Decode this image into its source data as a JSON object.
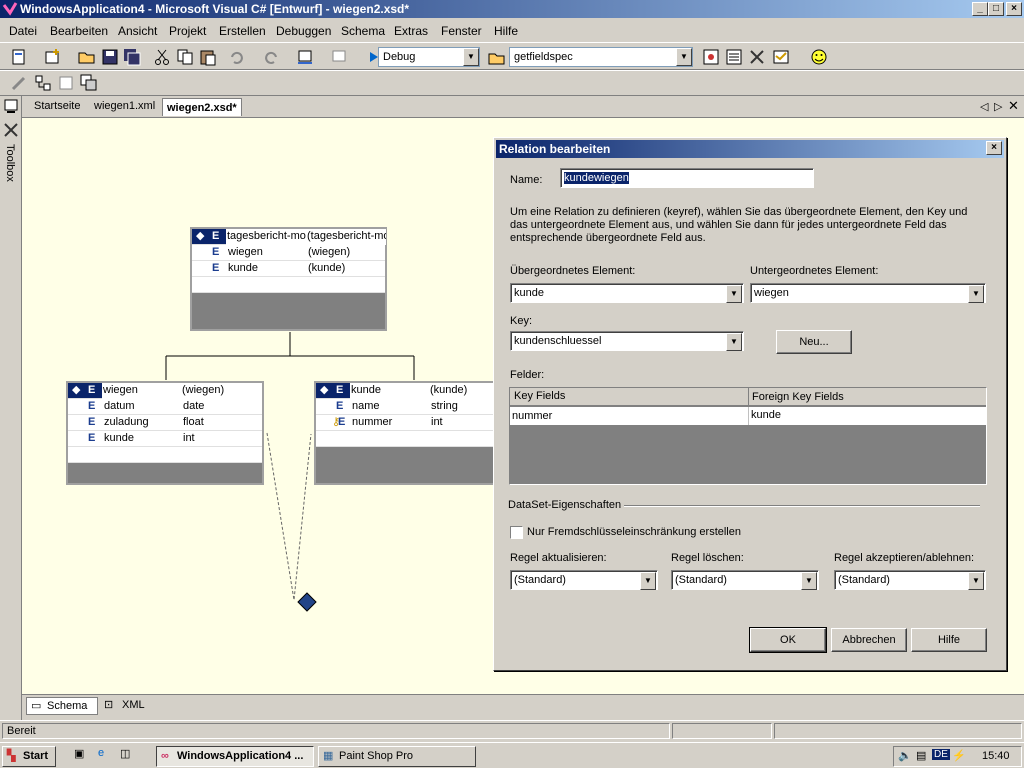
{
  "window": {
    "title": "WindowsApplication4 - Microsoft Visual C# [Entwurf] - wiegen2.xsd*"
  },
  "menu": [
    "Datei",
    "Bearbeiten",
    "Ansicht",
    "Projekt",
    "Erstellen",
    "Debuggen",
    "Schema",
    "Extras",
    "Fenster",
    "Hilfe"
  ],
  "toolbar": {
    "config": "Debug",
    "search": "getfieldspec"
  },
  "tabs": [
    "Startseite",
    "wiegen1.xml",
    "wiegen2.xsd*"
  ],
  "side": {
    "toolbox": "Toolbox"
  },
  "schema": {
    "root": {
      "rows": [
        {
          "t": "E",
          "name": "tagesbericht-mo",
          "type": "(tagesbericht-mo"
        },
        {
          "t": "E",
          "name": "wiegen",
          "type": "(wiegen)"
        },
        {
          "t": "E",
          "name": "kunde",
          "type": "(kunde)"
        }
      ]
    },
    "wiegen": {
      "rows": [
        {
          "t": "E",
          "name": "wiegen",
          "type": "(wiegen)"
        },
        {
          "t": "E",
          "name": "datum",
          "type": "date"
        },
        {
          "t": "E",
          "name": "zuladung",
          "type": "float"
        },
        {
          "t": "E",
          "name": "kunde",
          "type": "int"
        }
      ]
    },
    "kunde": {
      "rows": [
        {
          "t": "E",
          "name": "kunde",
          "type": "(kunde)"
        },
        {
          "t": "E",
          "name": "name",
          "type": "string"
        },
        {
          "t": "E",
          "name": "nummer",
          "type": "int"
        }
      ]
    }
  },
  "dialog": {
    "title": "Relation bearbeiten",
    "name_label": "Name:",
    "name_value": "kundewiegen",
    "description": "Um eine Relation zu definieren (keyref), wählen Sie das übergeordnete Element, den Key und das untergeordnete Element aus, und wählen Sie dann für jedes untergeordnete Feld das entsprechende übergeordnete Feld aus.",
    "parent_label": "Übergeordnetes Element:",
    "parent_value": "kunde",
    "child_label": "Untergeordnetes Element:",
    "child_value": "wiegen",
    "key_label": "Key:",
    "key_value": "kundenschluessel",
    "new_button": "Neu...",
    "fields_label": "Felder:",
    "col_key": "Key Fields",
    "col_foreign": "Foreign Key Fields",
    "row_key": "nummer",
    "row_foreign": "kunde",
    "dataset_label": "DataSet-Eigenschaften",
    "checkbox_label": "Nur Fremdschlüsseleinschränkung erstellen",
    "update_label": "Regel aktualisieren:",
    "update_value": "(Standard)",
    "delete_label": "Regel löschen:",
    "delete_value": "(Standard)",
    "accept_label": "Regel akzeptieren/ablehnen:",
    "accept_value": "(Standard)",
    "ok": "OK",
    "cancel": "Abbrechen",
    "help": "Hilfe"
  },
  "bottom_tabs": [
    "Schema",
    "XML"
  ],
  "status": {
    "text": "Bereit"
  },
  "taskbar": {
    "start": "Start",
    "task1": "WindowsApplication4 ...",
    "task2": "Paint Shop Pro",
    "lang": "DE",
    "time": "15:40"
  }
}
